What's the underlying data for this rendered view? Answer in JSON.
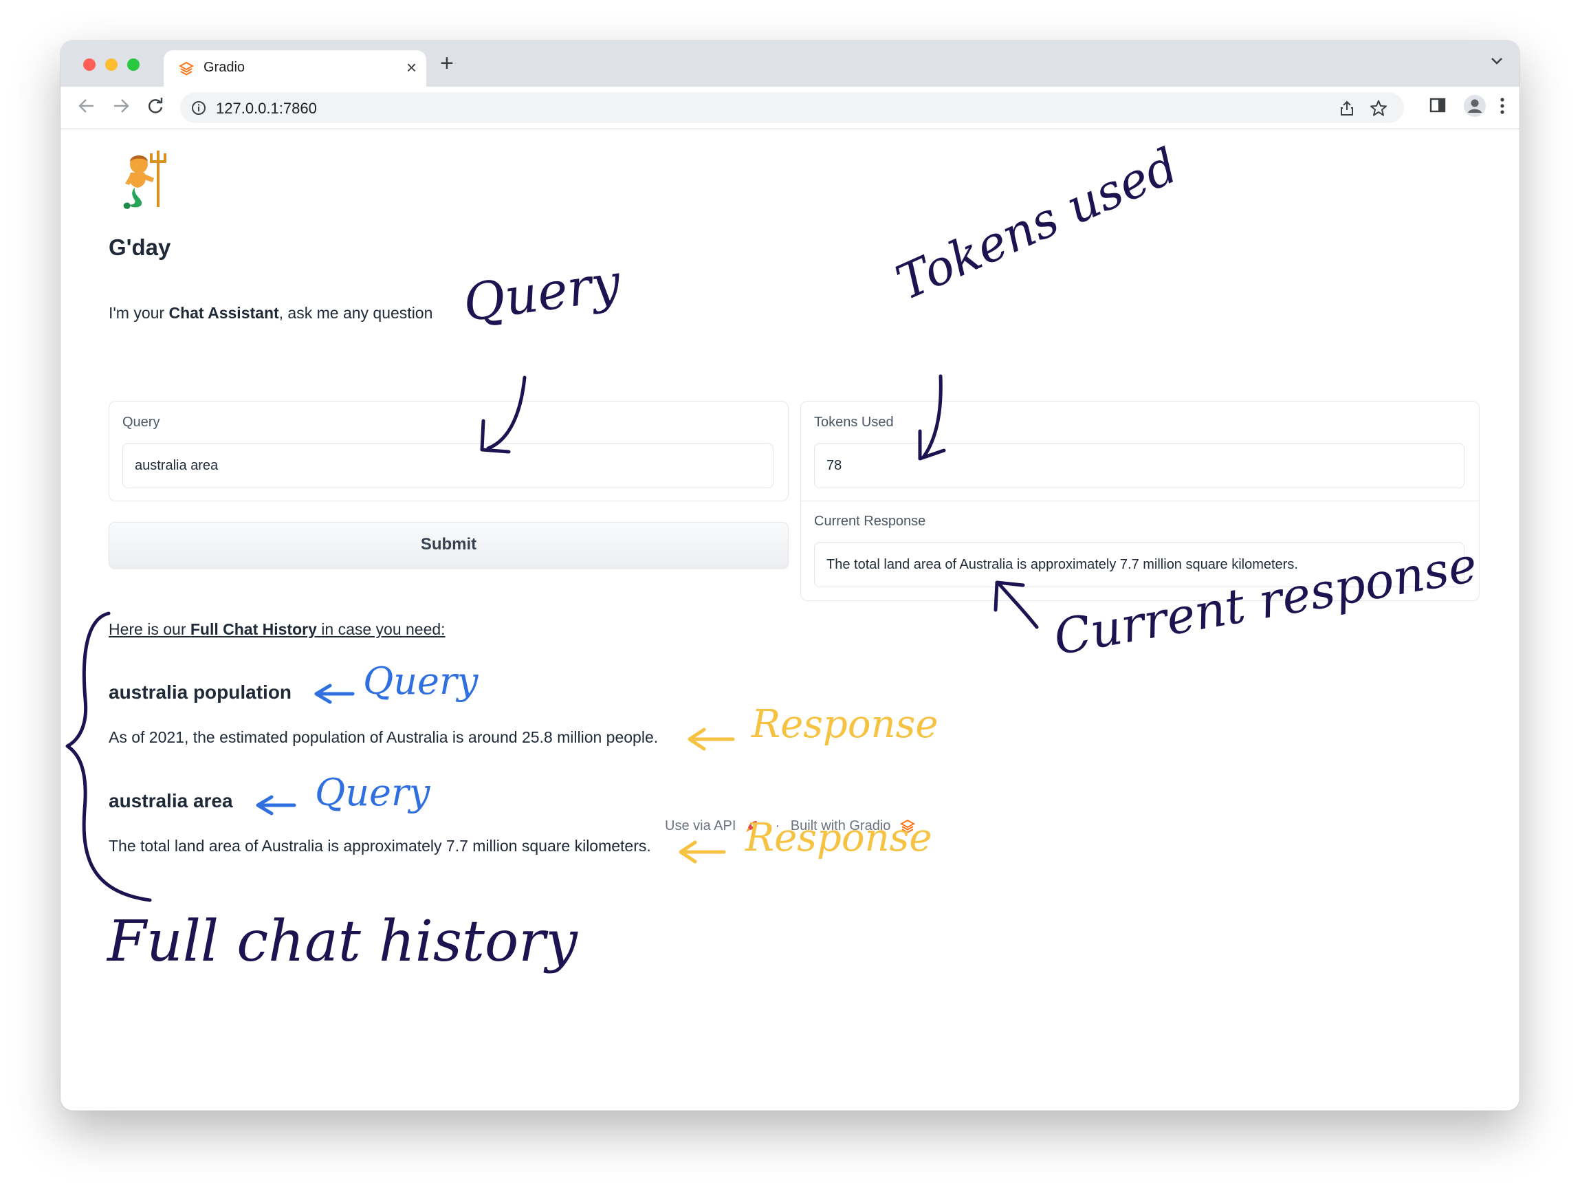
{
  "browser": {
    "tab_title": "Gradio",
    "url": "127.0.0.1:7860"
  },
  "app": {
    "logo_emoji": "🧜‍♂️",
    "heading": "G'day",
    "intro_before": "I'm your ",
    "intro_bold": "Chat Assistant",
    "intro_after": ", ask me any question",
    "query_label": "Query",
    "query_value": "australia area",
    "submit_label": "Submit",
    "tokens_label": "Tokens Used",
    "tokens_value": "78",
    "response_label": "Current Response",
    "response_value": "The total land area of Australia is approximately 7.7 million square kilometers."
  },
  "history": {
    "intro_before": "Here is our ",
    "intro_bold": "Full Chat History",
    "intro_after": " in case you need:",
    "entries": [
      {
        "query": "australia population",
        "response": "As of 2021, the estimated population of Australia is around 25.8 million people."
      },
      {
        "query": "australia area",
        "response": "The total land area of Australia is approximately 7.7 million square kilometers."
      }
    ]
  },
  "footer": {
    "api_label": "Use via API",
    "separator": "·",
    "built_label": "Built with Gradio"
  },
  "annotations": {
    "query_top": "Query",
    "tokens_used": "Tokens used",
    "current_response": "Current response",
    "history_query_1": "Query",
    "history_response_1": "Response",
    "history_query_2": "Query",
    "history_response_2": "Response",
    "full_chat_history": "Full chat history"
  },
  "colors": {
    "ink_purple": "#1e1250",
    "ink_blue": "#2f6fe0",
    "ink_yellow": "#f5c242",
    "gradio_orange": "#f97316"
  }
}
